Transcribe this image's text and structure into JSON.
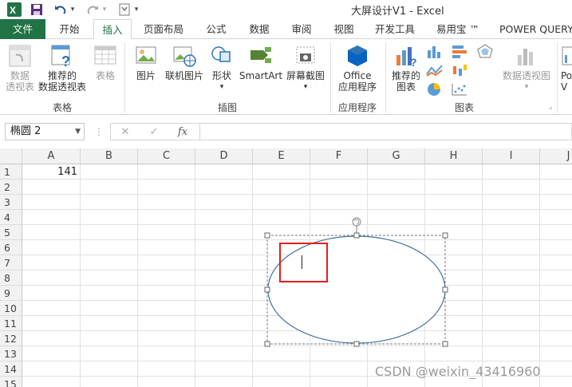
{
  "window": {
    "title": "大屏设计V1 - Excel"
  },
  "quick_access": {
    "customize_label": "▾"
  },
  "tabs": [
    {
      "label": "文件"
    },
    {
      "label": "开始"
    },
    {
      "label": "插入"
    },
    {
      "label": "页面布局"
    },
    {
      "label": "公式"
    },
    {
      "label": "数据"
    },
    {
      "label": "审阅"
    },
    {
      "label": "视图"
    },
    {
      "label": "开发工具"
    },
    {
      "label": "易用宝 ™"
    },
    {
      "label": "POWER QUERY"
    }
  ],
  "ribbon": {
    "groups": {
      "tables": "表格",
      "illustrations": "插图",
      "apps": "应用程序",
      "charts": "图表"
    },
    "buttons": {
      "pivot_table_1": "数据",
      "pivot_table_2": "透视表",
      "recommended_pivot_1": "推荐的",
      "recommended_pivot_2": "数据透视表",
      "table": "表格",
      "pictures": "图片",
      "online_pictures": "联机图片",
      "shapes": "形状",
      "smartart": "SmartArt",
      "screenshot": "屏幕截图",
      "office_apps_1": "Office",
      "office_apps_2": "应用程序",
      "recommended_charts_1": "推荐的",
      "recommended_charts_2": "图表",
      "pivot_chart": "数据透视图",
      "power_view_1": "Po",
      "power_view_2": "V"
    }
  },
  "formula_bar": {
    "name_box": "椭圆 2",
    "cancel": "✕",
    "enter": "✓",
    "fx": "fx",
    "formula": ""
  },
  "sheet": {
    "columns": [
      "A",
      "B",
      "C",
      "D",
      "E",
      "F",
      "G",
      "H",
      "I",
      "J"
    ],
    "rows": [
      "1",
      "2",
      "3",
      "4",
      "5",
      "6",
      "7",
      "8",
      "9",
      "10",
      "11",
      "12",
      "13",
      "14",
      "15"
    ],
    "cells": {
      "A1": "141"
    }
  },
  "shape": {
    "name": "椭圆 2",
    "type": "ellipse",
    "selected": true,
    "text": ""
  },
  "colors": {
    "excel_green": "#217346",
    "highlight_red": "#e81c1c",
    "ellipse_stroke": "#41719c"
  },
  "watermark": "CSDN @weixin_43416960"
}
